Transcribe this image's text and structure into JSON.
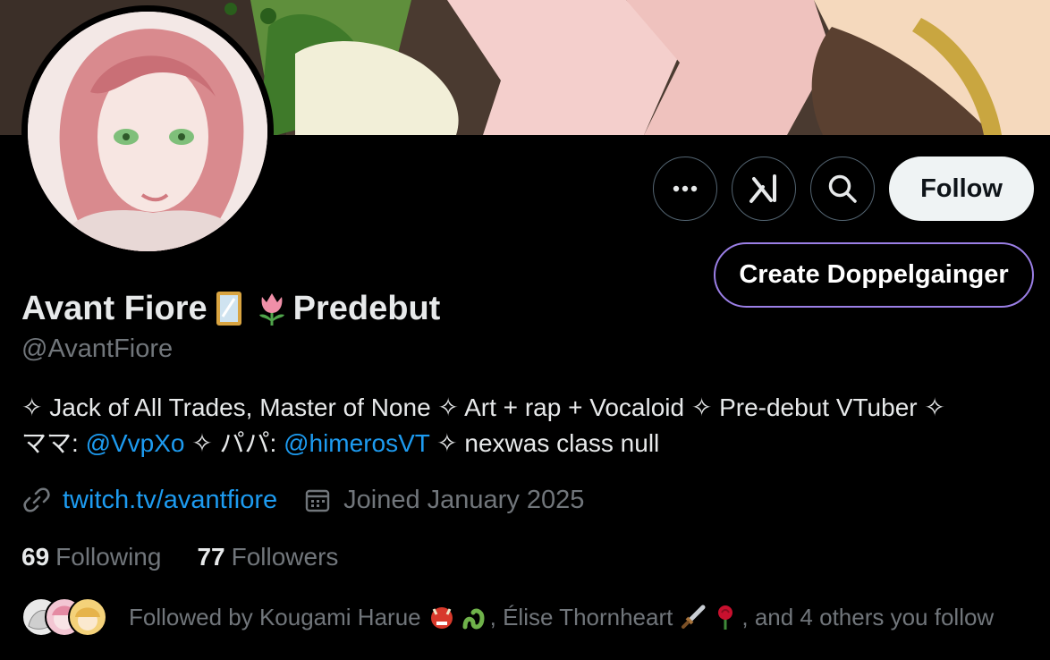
{
  "profile": {
    "display_name": "Avant Fiore",
    "display_name_suffix": "Predebut",
    "handle": "@AvantFiore",
    "bio": {
      "line1": "✧ Jack of All Trades, Master of None ✧ Art + rap + Vocaloid ✧ Pre-debut VTuber ✧",
      "line2_prefix": "ママ: ",
      "mention1": "@VvpXo",
      "line2_mid": " ✧ パパ: ",
      "mention2": "@himerosVT",
      "line2_suffix": " ✧ nexwas class null"
    },
    "website": "twitch.tv/avantfiore",
    "joined": "Joined January 2025",
    "following_count": "69",
    "following_label": "Following",
    "followers_count": "77",
    "followers_label": "Followers",
    "followed_by": {
      "prefix": "Followed by Kougami Harue",
      "middle": ", Élise Thornheart",
      "suffix": ", and 4 others you follow"
    }
  },
  "actions": {
    "more_icon": "more-horizontal-icon",
    "grok_icon": "grok-icon",
    "search_icon": "search-icon",
    "follow_label": "Follow",
    "doppel_label": "Create Doppelgainger"
  },
  "colors": {
    "accent": "#1d9bf0",
    "muted": "#71767b",
    "doppel_border": "#9b7fe6",
    "follow_bg": "#eff3f4"
  }
}
